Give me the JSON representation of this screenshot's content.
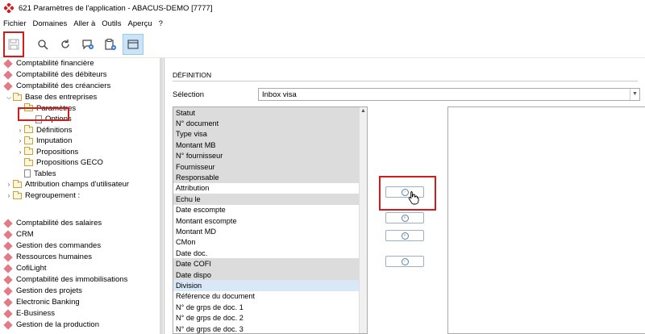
{
  "window": {
    "title": "621 Paramètres de l'application - ABACUS-DEMO [7777]"
  },
  "menu": [
    "Fichier",
    "Domaines",
    "Aller à",
    "Outils",
    "Aperçu",
    "?"
  ],
  "toolbar": {
    "icons": [
      "save-icon",
      "search-icon",
      "refresh-icon",
      "comment-add-icon",
      "clipboard-add-icon",
      "window-icon"
    ]
  },
  "tree": {
    "items": [
      {
        "label": "Comptabilité financière",
        "type": "module",
        "indent": 0
      },
      {
        "label": "Comptabilité des débiteurs",
        "type": "module",
        "indent": 0
      },
      {
        "label": "Comptabilité des créanciers",
        "type": "module",
        "indent": 0
      },
      {
        "label": "Base des entreprises",
        "type": "folder",
        "expanded": true,
        "indent": 0
      },
      {
        "label": "Paramètres",
        "type": "folder",
        "expanded": true,
        "indent": 1
      },
      {
        "label": "Options",
        "type": "doc",
        "indent": 2
      },
      {
        "label": "Définitions",
        "type": "folder",
        "expanded": false,
        "indent": 1
      },
      {
        "label": "Imputation",
        "type": "folder",
        "expanded": false,
        "indent": 1
      },
      {
        "label": "Propositions",
        "type": "folder",
        "expanded": false,
        "indent": 1
      },
      {
        "label": "Propositions GECO",
        "type": "folder",
        "indent": 1
      },
      {
        "label": "Tables",
        "type": "doc",
        "indent": 1
      },
      {
        "label": "Attribution champs d'utilisateur",
        "type": "folder",
        "expanded": false,
        "indent": 0
      },
      {
        "label": "Regroupement :",
        "type": "folder",
        "expanded": false,
        "indent": 0
      },
      {
        "label": "Comptabilité des salaires",
        "type": "module",
        "indent": 0
      },
      {
        "label": "CRM",
        "type": "module",
        "indent": 0
      },
      {
        "label": "Gestion des commandes",
        "type": "module",
        "indent": 0
      },
      {
        "label": "Ressources humaines",
        "type": "module",
        "indent": 0
      },
      {
        "label": "CofiLight",
        "type": "module",
        "indent": 0
      },
      {
        "label": "Comptabilité des immobilisations",
        "type": "module",
        "indent": 0
      },
      {
        "label": "Gestion des projets",
        "type": "module",
        "indent": 0
      },
      {
        "label": "Electronic Banking",
        "type": "module",
        "indent": 0
      },
      {
        "label": "E-Business",
        "type": "module",
        "indent": 0
      },
      {
        "label": "Gestion de la production",
        "type": "module",
        "indent": 0
      }
    ]
  },
  "main": {
    "section_title": "DÉFINITION",
    "selection_label": "Sélection",
    "selection_value": "Inbox visa",
    "available_fields": [
      {
        "label": "Statut",
        "style": "grey"
      },
      {
        "label": "N° document",
        "style": "grey"
      },
      {
        "label": "Type visa",
        "style": "grey"
      },
      {
        "label": "Montant MB",
        "style": "grey"
      },
      {
        "label": "N° fournisseur",
        "style": "grey"
      },
      {
        "label": "Fournisseur",
        "style": "grey"
      },
      {
        "label": "Responsable",
        "style": "grey"
      },
      {
        "label": "Attribution",
        "style": "white"
      },
      {
        "label": "Echu le",
        "style": "grey"
      },
      {
        "label": "Date escompte",
        "style": "white"
      },
      {
        "label": "Montant escompte",
        "style": "white"
      },
      {
        "label": "Montant MD",
        "style": "white"
      },
      {
        "label": "CMon",
        "style": "white"
      },
      {
        "label": "Date doc.",
        "style": "white"
      },
      {
        "label": "Date COFI",
        "style": "grey"
      },
      {
        "label": "Date dispo",
        "style": "grey"
      },
      {
        "label": "Division",
        "style": "hl"
      },
      {
        "label": "Référence du document",
        "style": "white"
      },
      {
        "label": "N° de grps de doc. 1",
        "style": "white"
      },
      {
        "label": "N° de grps de doc. 2",
        "style": "white"
      },
      {
        "label": "N° de grps de doc. 3",
        "style": "white"
      }
    ],
    "move_buttons": [
      "move-right-icon",
      "move-all-right-icon",
      "move-all-left-icon",
      "move-left-icon"
    ]
  },
  "colors": {
    "accent_red": "#d11c1c",
    "module_diamond": "#e37b86",
    "selected_blue": "#d8e8f6"
  }
}
